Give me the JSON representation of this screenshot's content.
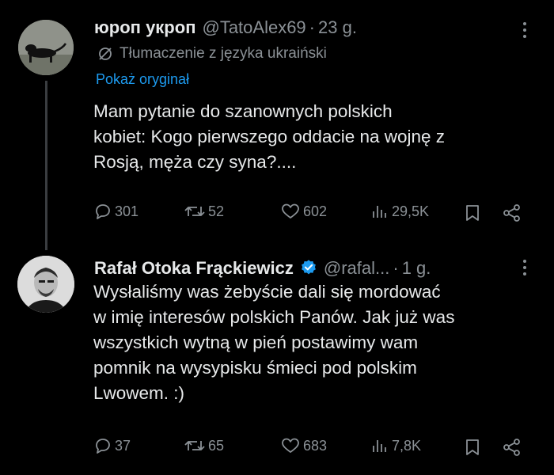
{
  "tweets": [
    {
      "author_name": "юроп укроп",
      "handle": "@TatoAlex69",
      "separator": "·",
      "time": "23 g.",
      "translation_note": "Tłumaczenie z języka ukraiński",
      "show_original": "Pokaż oryginał",
      "text_lines": [
        "Mam pytanie do szanownych polskich",
        "kobiet: Kogo pierwszego oddacie na wojnę z",
        "Rosją, męża czy syna?...."
      ],
      "replies": "301",
      "retweets": "52",
      "likes": "602",
      "views": "29,5K"
    },
    {
      "author_name": "Rafał Otoka Frąckiewicz",
      "handle": "@rafal...",
      "separator": "·",
      "time": "1 g.",
      "verified": true,
      "text_lines": [
        "Wysłaliśmy was żebyście dali się mordować",
        "w imię interesów polskich Panów. Jak już was",
        "wszystkich wytną w pień postawimy wam",
        "pomnik na wysypisku śmieci pod polskim",
        "Lwowem. :)"
      ],
      "replies": "37",
      "retweets": "65",
      "likes": "683",
      "views": "7,8K"
    }
  ],
  "colors": {
    "background": "#000000",
    "text": "#e7e9ea",
    "secondary": "#8b9196",
    "link": "#1d9bf0",
    "verified": "#1d9bf0"
  }
}
